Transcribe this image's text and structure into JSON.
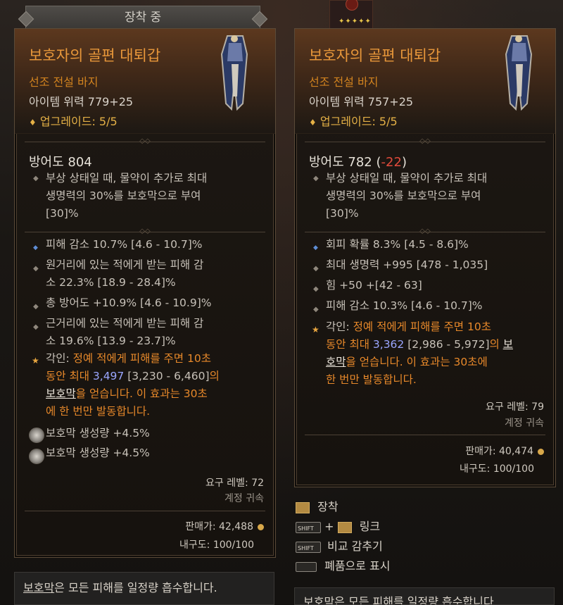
{
  "header": {
    "equipped_tab": "장착 중",
    "stars": "✦✦✦✦✦"
  },
  "equipped": {
    "title": "보호자의 골편 대퇴갑",
    "type": "선조 전설 바지",
    "power": "아이템 위력 779+25",
    "upgrade": "업그레이드: 5/5",
    "armor": "방어도 804",
    "implicit": [
      "부상 상태일 때, 물약이 추가로 최대",
      "생명력의 30%를 보호막으로 부여",
      "[30]%"
    ],
    "affixes": [
      {
        "bullet": "blue",
        "lines": [
          "피해 감소 10.7% [4.6 - 10.7]%"
        ]
      },
      {
        "bullet": "grey",
        "lines": [
          "원거리에 있는 적에게 받는 피해 감",
          "소 22.3% [18.9 - 28.4]%"
        ]
      },
      {
        "bullet": "grey",
        "lines": [
          "총 방어도 +10.9% [4.6 - 10.9]%"
        ]
      },
      {
        "bullet": "grey",
        "lines": [
          "근거리에 있는 적에게 받는 피해 감",
          "소 19.6% [13.9 - 23.7]%"
        ]
      }
    ],
    "aspect": {
      "l1_label": "각인: ",
      "l1_text": "정예 적에게 피해를 주면 10초",
      "l2_a": "동안 최대 ",
      "l2_val": "3,497",
      "l2_rng": " [3,230 - 6,460]",
      "l2_b": "의",
      "l3_kw": "보호막",
      "l3_text": "을 얻습니다. 이 효과는 30초",
      "l4_text": "에 한 번만 발동합니다."
    },
    "sockets": [
      "보호막 생성량 +4.5%",
      "보호막 생성량 +4.5%"
    ],
    "req_level": "요구 레벨: 72",
    "account_bound": "계정 귀속",
    "sell_price": "판매가: 42,488",
    "durability": "내구도: 100/100"
  },
  "compare": {
    "title": "보호자의 골편 대퇴갑",
    "type": "선조 전설 바지",
    "power": "아이템 위력 757+25",
    "upgrade": "업그레이드: 5/5",
    "armor": "방어도 782",
    "armor_delta_open": "(",
    "armor_delta": "-22",
    "armor_delta_close": ")",
    "implicit": [
      "부상 상태일 때, 물약이 추가로 최대",
      "생명력의 30%를 보호막으로 부여",
      "[30]%"
    ],
    "affixes": [
      {
        "bullet": "blue",
        "lines": [
          "회피 확률 8.3% [4.5 - 8.6]%"
        ]
      },
      {
        "bullet": "grey",
        "lines": [
          "최대 생명력 +995 [478 - 1,035]"
        ]
      },
      {
        "bullet": "grey",
        "lines": [
          "힘 +50 +[42 - 63]"
        ]
      },
      {
        "bullet": "grey",
        "lines": [
          "피해 감소 10.3% [4.6 - 10.7]%"
        ]
      }
    ],
    "aspect": {
      "l1_label": "각인: ",
      "l1_text": "정예 적에게 피해를 주면 10초",
      "l2_a": "동안 최대 ",
      "l2_val": "3,362",
      "l2_rng": " [2,986 - 5,972]",
      "l2_b": "의 ",
      "l2_kw": "보",
      "l3_kw": "호막",
      "l3_text": "을 얻습니다. 이 효과는 30초에",
      "l4_text": "한 번만 발동합니다."
    },
    "req_level": "요구 레벨: 79",
    "account_bound": "계정 귀속",
    "sell_price": "판매가: 40,474",
    "durability": "내구도: 100/100"
  },
  "actions": {
    "equip": "장착",
    "shift_key": "SHIFT",
    "plus": "+",
    "link": "링크",
    "hide_compare": "비교 감추기",
    "mark_junk": "폐품으로 표시"
  },
  "notes": {
    "left_kw": "보호막",
    "left_text": "은 모든 피해를 일정량 흡수합니다.",
    "right_kw": "보호막",
    "right_text": "은 모든 피해를 일정량 흡수합니다."
  }
}
